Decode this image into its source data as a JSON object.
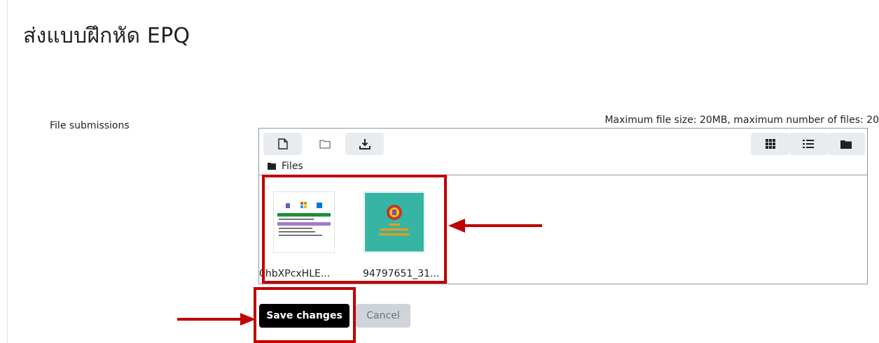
{
  "page": {
    "title": "ส่งแบบฝึกหัด EPQ"
  },
  "form": {
    "field_label": "File submissions",
    "limits_text": "Maximum file size: 20MB, maximum number of files: 20"
  },
  "filemanager": {
    "toolbar": {
      "add_icon": "file-icon",
      "create_folder_icon": "folder-outline-icon",
      "download_icon": "download-icon",
      "view_icons": [
        "grid-icon",
        "list-icon",
        "folder-icon"
      ]
    },
    "path": {
      "label": "Files"
    },
    "files": [
      {
        "name": "0hbXPcxHLE..."
      },
      {
        "name": "94797651_31..."
      }
    ]
  },
  "buttons": {
    "save": "Save changes",
    "cancel": "Cancel"
  },
  "colors": {
    "annotation_red": "#c00000",
    "primary_button": "#000000",
    "secondary_button": "#ced4da",
    "thumb2_bg": "#36b5a5"
  }
}
